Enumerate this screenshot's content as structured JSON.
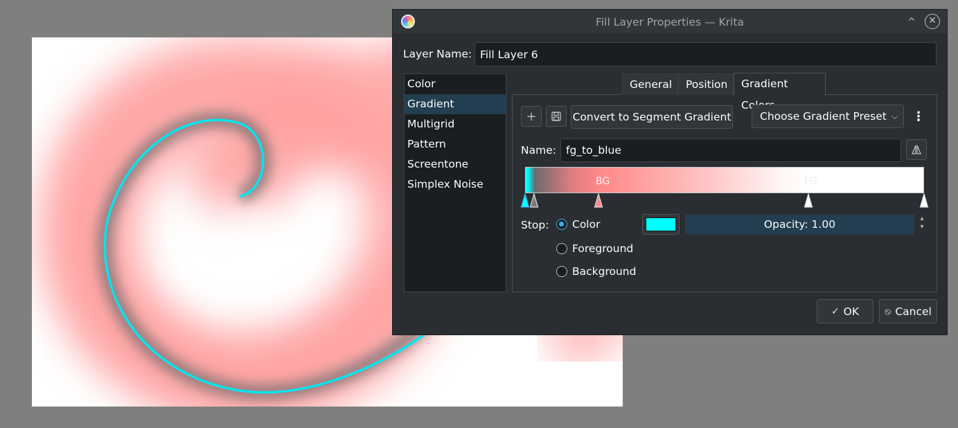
{
  "window": {
    "title": "Fill Layer Properties — Krita",
    "minimize_glyph": "^",
    "close_glyph": "✕"
  },
  "layer_name": {
    "label": "Layer Name:",
    "value": "Fill Layer 6"
  },
  "fill_types": {
    "items": [
      "Color",
      "Gradient",
      "Multigrid",
      "Pattern",
      "Screentone",
      "Simplex Noise"
    ],
    "selected": "Gradient"
  },
  "tabs": {
    "items": [
      "General",
      "Position",
      "Gradient Colors"
    ],
    "active": "Gradient Colors"
  },
  "toolbar": {
    "add_icon": "plus-icon",
    "save_icon": "save-icon",
    "convert_label": "Convert to Segment Gradient",
    "preset_label": "Choose Gradient Preset",
    "more_icon": "kebab-menu-icon"
  },
  "gradient": {
    "name_label": "Name:",
    "name_value": "fg_to_blue",
    "reverse_icon": "reverse-icon",
    "bg_tag": "BG",
    "fg_tag": "FG",
    "stops": [
      {
        "position": 0.0,
        "color": "#00ffff"
      },
      {
        "position": 0.022,
        "color": "#7a7a7a"
      },
      {
        "position": 0.184,
        "color": "#ff8888"
      },
      {
        "position": 0.71,
        "color": "#ffffff"
      },
      {
        "position": 1.0,
        "color": "#ffffff"
      }
    ]
  },
  "stop_editor": {
    "label": "Stop:",
    "options": [
      "Color",
      "Foreground",
      "Background"
    ],
    "selected": "Color",
    "color": "#00ffff",
    "opacity_text": "Opacity: 1.00"
  },
  "buttons": {
    "ok_label": "OK",
    "cancel_label": "Cancel"
  },
  "colors": {
    "accent": "#3daee9",
    "selection": "#233e50",
    "spiral_line": "#00e5f0",
    "spiral_fill": "#ff8888"
  }
}
